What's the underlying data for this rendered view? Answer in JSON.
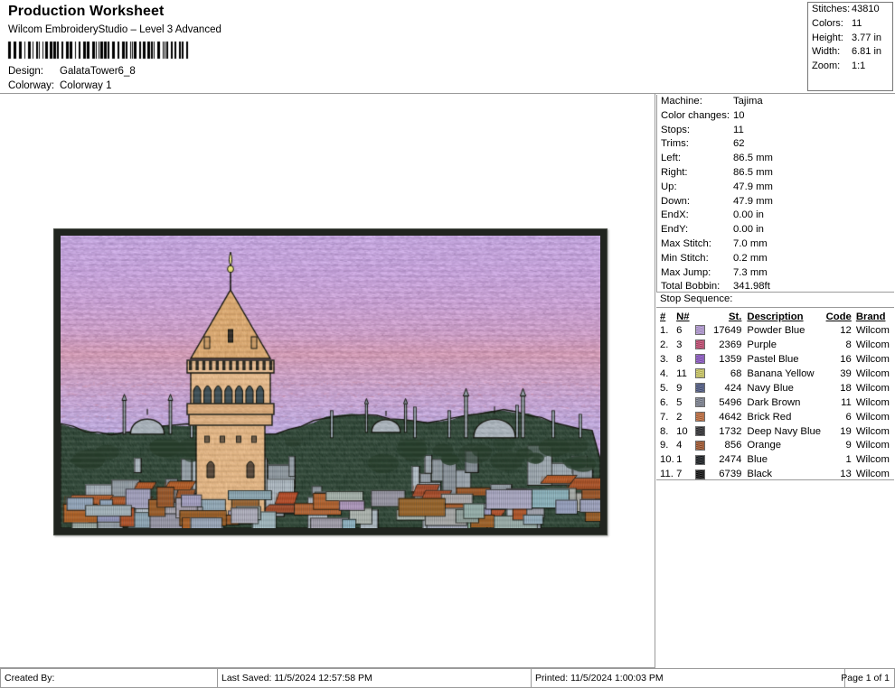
{
  "header": {
    "title": "Production Worksheet",
    "subtitle": "Wilcom EmbroideryStudio – Level 3 Advanced",
    "design_label": "Design:",
    "design_value": "GalataTower6_8",
    "colorway_label": "Colorway:",
    "colorway_value": "Colorway 1"
  },
  "stats": [
    {
      "label": "Stitches:",
      "value": "43810"
    },
    {
      "label": "Colors:",
      "value": "11"
    },
    {
      "label": "Height:",
      "value": "3.77 in"
    },
    {
      "label": "Width:",
      "value": "6.81 in"
    },
    {
      "label": "Zoom:",
      "value": "1:1"
    }
  ],
  "info": [
    {
      "label": "Machine:",
      "value": "Tajima"
    },
    {
      "label": "Color changes:",
      "value": "10"
    },
    {
      "label": "Stops:",
      "value": "11"
    },
    {
      "label": "Trims:",
      "value": "62"
    },
    {
      "label": "Left:",
      "value": "86.5 mm"
    },
    {
      "label": "Right:",
      "value": "86.5 mm"
    },
    {
      "label": "Up:",
      "value": "47.9 mm"
    },
    {
      "label": "Down:",
      "value": "47.9 mm"
    },
    {
      "label": "EndX:",
      "value": "0.00 in"
    },
    {
      "label": "EndY:",
      "value": "0.00 in"
    },
    {
      "label": "Max Stitch:",
      "value": "7.0 mm"
    },
    {
      "label": "Min Stitch:",
      "value": "0.2 mm"
    },
    {
      "label": "Max Jump:",
      "value": "7.3 mm"
    },
    {
      "label": "Total Bobbin:",
      "value": "341.98ft"
    }
  ],
  "stop_sequence": {
    "section_label": "Stop Sequence:",
    "columns": [
      "#",
      "N#",
      "",
      "St.",
      "Description",
      "Code",
      "Brand"
    ],
    "rows": [
      {
        "idx": "1.",
        "n": "6",
        "color": "#b49ad6",
        "stitches": "17649",
        "description": "Powder Blue",
        "code": "12",
        "brand": "Wilcom"
      },
      {
        "idx": "2.",
        "n": "3",
        "color": "#c2486f",
        "stitches": "2369",
        "description": "Purple",
        "code": "8",
        "brand": "Wilcom"
      },
      {
        "idx": "3.",
        "n": "8",
        "color": "#8b55c4",
        "stitches": "1359",
        "description": "Pastel Blue",
        "code": "16",
        "brand": "Wilcom"
      },
      {
        "idx": "4.",
        "n": "11",
        "color": "#cdc962",
        "stitches": "68",
        "description": "Banana Yellow",
        "code": "39",
        "brand": "Wilcom"
      },
      {
        "idx": "5.",
        "n": "9",
        "color": "#4b5782",
        "stitches": "424",
        "description": "Navy Blue",
        "code": "18",
        "brand": "Wilcom"
      },
      {
        "idx": "6.",
        "n": "5",
        "color": "#7b8190",
        "stitches": "5496",
        "description": "Dark Brown",
        "code": "11",
        "brand": "Wilcom"
      },
      {
        "idx": "7.",
        "n": "2",
        "color": "#c06a3a",
        "stitches": "4642",
        "description": "Brick Red",
        "code": "6",
        "brand": "Wilcom"
      },
      {
        "idx": "8.",
        "n": "10",
        "color": "#2b2b2f",
        "stitches": "1732",
        "description": "Deep Navy Blue",
        "code": "19",
        "brand": "Wilcom"
      },
      {
        "idx": "9.",
        "n": "4",
        "color": "#a0532a",
        "stitches": "856",
        "description": "Orange",
        "code": "9",
        "brand": "Wilcom"
      },
      {
        "idx": "10.",
        "n": "1",
        "color": "#14181c",
        "stitches": "2474",
        "description": "Blue",
        "code": "1",
        "brand": "Wilcom"
      },
      {
        "idx": "11.",
        "n": "7",
        "color": "#0c0c0c",
        "stitches": "6739",
        "description": "Black",
        "code": "13",
        "brand": "Wilcom"
      }
    ]
  },
  "artwork": {
    "title": "Galata Tower embroidery design preview",
    "sky_top": "#c3a4dc",
    "sky_mid": "#c49ec8",
    "sky_low": "#d39ba8",
    "stone": "#e0b484",
    "foliage": "#2f4733",
    "roof": "#b9632c",
    "building": "#aeb6bd",
    "outline": "#15160f"
  },
  "footer": {
    "created_by": "Created By:",
    "last_saved": "Last Saved: 11/5/2024 12:57:58 PM",
    "printed": "Printed: 11/5/2024 1:00:03 PM",
    "page": "Page 1 of 1"
  }
}
